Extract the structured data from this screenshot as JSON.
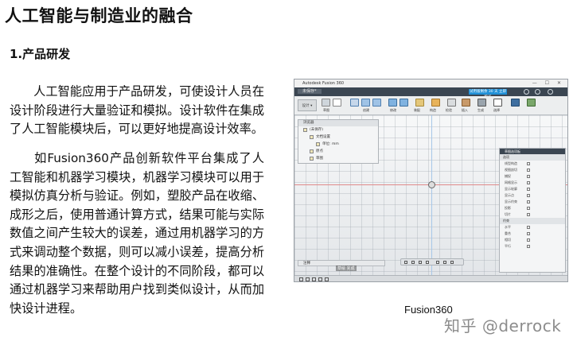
{
  "page": {
    "title": "人工智能与制造业的融合",
    "section_heading": "1.产品研发",
    "paragraph_1": "人工智能应用于产品研发，可使设计人员在设计阶段进行大量验证和模拟。设计软件在集成了人工智能模块后，可以更好地提高设计效率。",
    "paragraph_2": "如Fusion360产品创新软件平台集成了人工智能和机器学习模块，机器学习模块可以用于模拟仿真分析与验证。例如，塑胶产品在收缩、成形之后，使用普通计算方式，结果可能与实际数值之间产生较大的误差，通过用机器学习的方式来调动整个数据，则可以减小误差，提高分析结果的准确性。在整个设计的不同阶段，都可以通过机器学习来帮助用户找到类似设计，从而加快设计进程。",
    "figure_caption": "Fusion360",
    "watermark": "知乎 @derrock"
  },
  "screenshot": {
    "app_title": "Autodesk Fusion 360",
    "window_controls": "— ☐ ✕",
    "quick_tab": "未保存*",
    "trial_banner": "试用版剩余 30 天 立即购买",
    "workspace_button": "设计 ▾",
    "ribbon_groups": [
      "草图",
      "创建",
      "修改",
      "装配",
      "构造",
      "检验",
      "插入",
      "生成",
      "选择"
    ],
    "browser_header": "浏览器",
    "browser_rows": [
      "(未保存)",
      "文档设置",
      "单位: mm",
      "原点",
      "草图"
    ],
    "properties_header": "草图选项板",
    "properties_sections": [
      "选项",
      "约束"
    ],
    "properties_rows": [
      "线型构造",
      "视图剖切",
      "捕捉",
      "网格显示",
      "显示轮廓",
      "显示点",
      "显示约束",
      "投影",
      "切片",
      "水平",
      "重合",
      "相切",
      "平行"
    ],
    "comments_label": "注释",
    "overlay_caption": "草绘 完成"
  }
}
